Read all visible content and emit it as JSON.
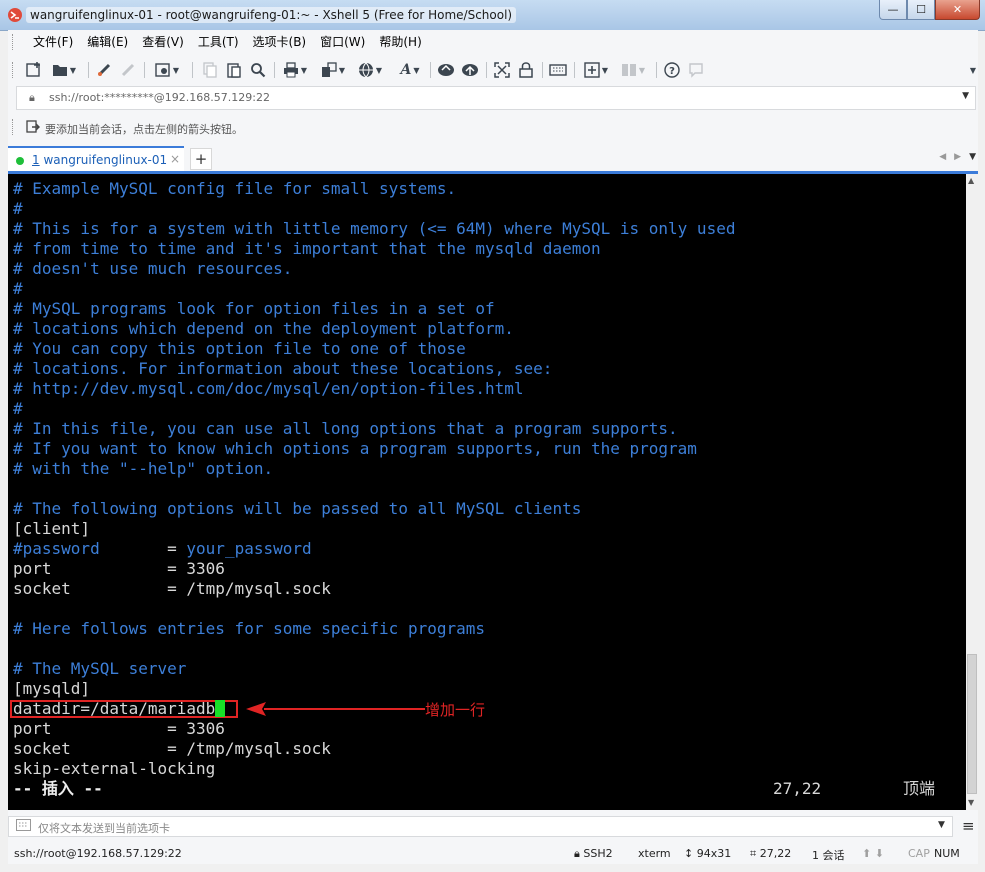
{
  "window": {
    "title": "wangruifenglinux-01 - root@wangruifeng-01:~ - Xshell 5 (Free for Home/School)",
    "controls": {
      "minimize": "—",
      "maximize": "☐",
      "close": "✕"
    },
    "app_icon": "xshell-logo-icon"
  },
  "menu": [
    "文件(F)",
    "编辑(E)",
    "查看(V)",
    "工具(T)",
    "选项卡(B)",
    "窗口(W)",
    "帮助(H)"
  ],
  "toolbar": {
    "icons": [
      "new-session-icon",
      "open-folder-icon",
      "connect-icon",
      "disconnect-icon",
      "properties-icon",
      "copy-icon",
      "paste-icon",
      "find-icon",
      "print-icon",
      "transfer-icon",
      "globe-icon",
      "font-icon",
      "xftp-icon",
      "xftp2-icon",
      "fullscreen-icon",
      "lock-icon",
      "keyboard-icon",
      "compose-icon",
      "layout-icon",
      "help-icon",
      "chat-icon"
    ]
  },
  "address": {
    "value": "ssh://root:*********@192.168.57.129:22"
  },
  "hint": {
    "text": "要添加当前会话，点击左侧的箭头按钮。"
  },
  "tabs": [
    {
      "number": "1",
      "label": "wangruifenglinux-01"
    }
  ],
  "terminal": {
    "lines": [
      {
        "text": "# Example MySQL config file for small systems.",
        "style": "comment"
      },
      {
        "text": "#",
        "style": "comment"
      },
      {
        "text": "# This is for a system with little memory (<= 64M) where MySQL is only used",
        "style": "comment"
      },
      {
        "text": "# from time to time and it's important that the mysqld daemon",
        "style": "comment"
      },
      {
        "text": "# doesn't use much resources.",
        "style": "comment"
      },
      {
        "text": "#",
        "style": "comment"
      },
      {
        "text": "# MySQL programs look for option files in a set of",
        "style": "comment"
      },
      {
        "text": "# locations which depend on the deployment platform.",
        "style": "comment"
      },
      {
        "text": "# You can copy this option file to one of those",
        "style": "comment"
      },
      {
        "text": "# locations. For information about these locations, see:",
        "style": "comment"
      },
      {
        "text": "# http://dev.mysql.com/doc/mysql/en/option-files.html",
        "style": "comment"
      },
      {
        "text": "#",
        "style": "comment"
      },
      {
        "text": "# In this file, you can use all long options that a program supports.",
        "style": "comment"
      },
      {
        "text": "# If you want to know which options a program supports, run the program",
        "style": "comment"
      },
      {
        "text": "# with the \"--help\" option.",
        "style": "comment"
      },
      {
        "text": "",
        "style": "plain"
      },
      {
        "text": "# The following options will be passed to all MySQL clients",
        "style": "comment"
      },
      {
        "text": "[client]",
        "style": "plain"
      },
      {
        "key": "#password",
        "value": "your_password",
        "style": "mixed"
      },
      {
        "text": "port            = 3306",
        "style": "plain"
      },
      {
        "text": "socket          = /tmp/mysql.sock",
        "style": "plain"
      },
      {
        "text": "",
        "style": "plain"
      },
      {
        "text": "# Here follows entries for some specific programs",
        "style": "comment"
      },
      {
        "text": "",
        "style": "plain"
      },
      {
        "text": "# The MySQL server",
        "style": "comment"
      },
      {
        "text": "[mysqld]",
        "style": "plain"
      },
      {
        "text": "datadir=/data/mariadb",
        "style": "plain"
      },
      {
        "text": "port            = 3306",
        "style": "plain"
      },
      {
        "text": "socket          = /tmp/mysql.sock",
        "style": "plain"
      },
      {
        "text": "skip-external-locking",
        "style": "plain"
      }
    ],
    "mode": "-- 插入 --",
    "cursor_pos": "27,22",
    "scroll_pos": "顶端",
    "colors": {
      "comment": "#3d7fd8",
      "text": "#d8d8d8",
      "cursor": "#18e028",
      "annotation": "#e02424"
    }
  },
  "annotation": {
    "label": "增加一行"
  },
  "send": {
    "placeholder": "仅将文本发送到当前选项卡"
  },
  "status": {
    "connection": "ssh://root@192.168.57.129:22",
    "protocol": "SSH2",
    "term": "xterm",
    "size": "94x31",
    "cursor": "27,22",
    "sessions": "1 会话",
    "cap": "CAP",
    "num": "NUM"
  }
}
